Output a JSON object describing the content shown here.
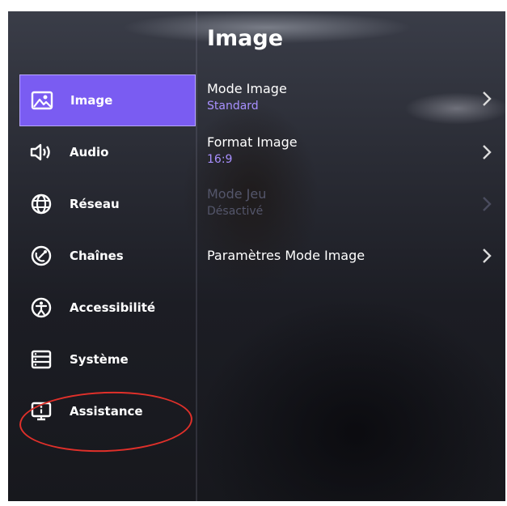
{
  "header": {
    "title": "Image"
  },
  "sidebar": {
    "items": [
      {
        "label": "Image",
        "icon": "picture-icon",
        "selected": true
      },
      {
        "label": "Audio",
        "icon": "speaker-icon"
      },
      {
        "label": "Réseau",
        "icon": "globe-icon"
      },
      {
        "label": "Chaînes",
        "icon": "antenna-icon"
      },
      {
        "label": "Accessibilité",
        "icon": "accessibility-icon"
      },
      {
        "label": "Système",
        "icon": "server-icon"
      },
      {
        "label": "Assistance",
        "icon": "info-monitor-icon"
      }
    ]
  },
  "settings": [
    {
      "label": "Mode Image",
      "value": "Standard",
      "enabled": true
    },
    {
      "label": "Format Image",
      "value": "16:9",
      "enabled": true
    },
    {
      "label": "Mode Jeu",
      "value": "Désactivé",
      "enabled": false
    },
    {
      "label": "Paramètres Mode Image",
      "value": "",
      "enabled": true
    }
  ],
  "colors": {
    "accent": "#7a5cf2",
    "value_text": "#a890ff",
    "annotation": "#e0302a"
  }
}
